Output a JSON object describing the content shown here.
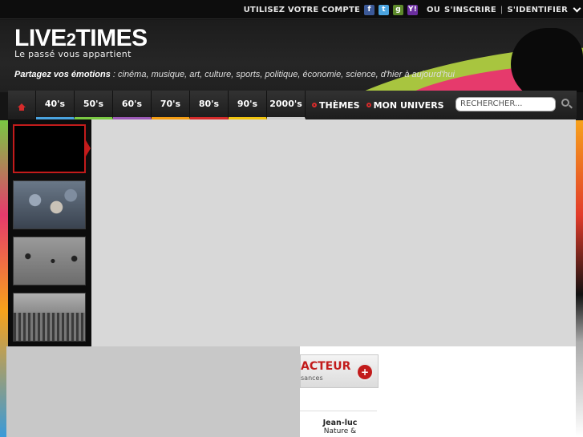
{
  "topbar": {
    "create_account": "UTILISEZ VOTRE COMPTE",
    "social_icons": [
      "facebook-icon",
      "twitter-icon",
      "google-icon",
      "yahoo-icon"
    ],
    "social_glyphs": [
      "f",
      "t",
      "g",
      "Y!"
    ],
    "or": "OU",
    "register": "S'INSCRIRE",
    "separator": "|",
    "login": "S'IDENTIFIER"
  },
  "header": {
    "logo_a": "LIVE",
    "logo_two": "2",
    "logo_b": "TIMES",
    "tagline": "Le passé vous appartient",
    "share_bold": "Partagez vos émotions",
    "share_rest": " : cinéma, musique, art, culture, sports, politique, économie, science, d'hier à aujourd'hui"
  },
  "nav": {
    "home_icon": "home-icon",
    "decades": [
      {
        "label": "40's",
        "color": "#4aa3df"
      },
      {
        "label": "50's",
        "color": "#7ac943"
      },
      {
        "label": "60's",
        "color": "#9b59b6"
      },
      {
        "label": "70's",
        "color": "#f39c12"
      },
      {
        "label": "80's",
        "color": "#d52b2b"
      },
      {
        "label": "90's",
        "color": "#f1c40f"
      },
      {
        "label": "2000's",
        "color": "#cccccc"
      }
    ],
    "themes": "THÈMES",
    "universe": "MON UNIVERS",
    "search_placeholder": "RECHERCHER..."
  },
  "slider": {
    "thumbs": [
      "active",
      "crowd",
      "planes",
      "troops"
    ]
  },
  "lower": {
    "acteur_title": "ACTEUR",
    "acteur_sub": "sances",
    "acteur_plus": "+",
    "person_name": "Jean-luc",
    "person_sub": "Nature &"
  },
  "colors": {
    "accent": "#c21b1b",
    "nav_bg": "#1c1c1c"
  }
}
